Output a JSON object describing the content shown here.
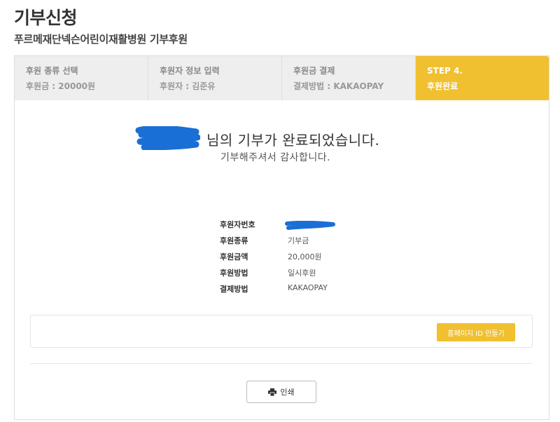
{
  "header": {
    "title": "기부신청",
    "subtitle": "푸르메재단넥슨어린이재활병원 기부후원"
  },
  "steps": [
    {
      "title": "후원 종류 선택",
      "value": "후원금 : 20000원",
      "active": false
    },
    {
      "title": "후원자 정보 입력",
      "value": "후원자 : 김준유",
      "active": false
    },
    {
      "title": "후원금 결제",
      "value": "결제방법 : KAKAOPAY",
      "active": false
    },
    {
      "title": "STEP 4.",
      "value": "후원완료",
      "active": true
    }
  ],
  "completion": {
    "message": "님의 기부가 완료되었습니다.",
    "thanks": "기부해주셔서 감사합니다."
  },
  "info": {
    "rows": [
      {
        "label": "후원자번호",
        "value": ""
      },
      {
        "label": "후원종류",
        "value": "기부금"
      },
      {
        "label": "후원금액",
        "value": "20,000원"
      },
      {
        "label": "후원방법",
        "value": "일시후원"
      },
      {
        "label": "결제방법",
        "value": "KAKAOPAY"
      }
    ]
  },
  "actions": {
    "homepage_id_label": "홈페이지 ID 만들기",
    "print_label": "인쇄"
  },
  "colors": {
    "accent": "#f0c030",
    "redaction": "#1a6fd6"
  },
  "icons": {
    "print": "printer-icon",
    "redaction": "redaction-scribble"
  }
}
